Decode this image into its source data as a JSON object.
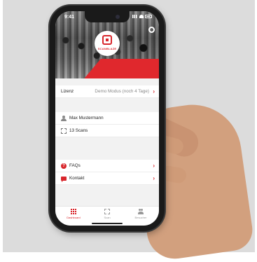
{
  "status_bar": {
    "time": "9:41"
  },
  "header": {
    "logo_text": "SCANBLAZE",
    "settings_icon": "gear-icon"
  },
  "license": {
    "label": "Lizenz",
    "value": "Demo Modus (noch 4 Tage)"
  },
  "user": {
    "name": "Max Mustermann",
    "scans": "13 Scans"
  },
  "links": [
    {
      "label": "FAQs",
      "icon": "question-icon"
    },
    {
      "label": "Kontakt",
      "icon": "chat-icon"
    }
  ],
  "tabs": [
    {
      "label": "Dashboard",
      "icon": "grid-icon",
      "active": true
    },
    {
      "label": "Scan",
      "icon": "scan-icon",
      "active": false
    },
    {
      "label": "Besucher",
      "icon": "users-icon",
      "active": false
    }
  ],
  "colors": {
    "accent": "#d8262c",
    "text": "#222222",
    "muted": "#888888"
  }
}
